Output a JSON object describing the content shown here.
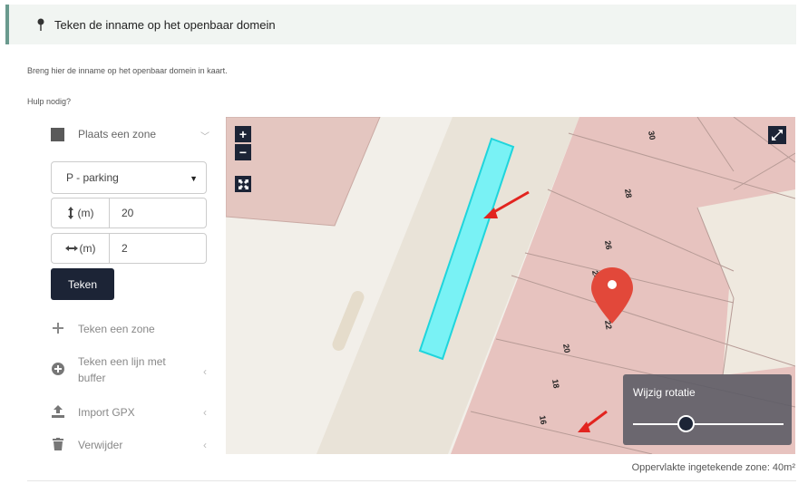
{
  "header": {
    "title": "Teken de inname op het openbaar domein",
    "icon": "map-pin-icon"
  },
  "intro": "Breng hier de inname op het openbaar domein in kaart.",
  "help": "Hulp nodig?",
  "sidebar": {
    "zone_header": "Plaats een zone",
    "select_value": "P - parking",
    "length": {
      "label": "(m)",
      "value": "20"
    },
    "width": {
      "label": "(m)",
      "value": "2"
    },
    "draw_button": "Teken",
    "tools": [
      {
        "label": "Teken een zone",
        "icon": "plus-icon"
      },
      {
        "label": "Teken een lijn met buffer",
        "icon": "plus-circle-icon"
      },
      {
        "label": "Import GPX",
        "icon": "upload-icon"
      },
      {
        "label": "Verwijder",
        "icon": "trash-icon"
      }
    ]
  },
  "map": {
    "zoom_in": "+",
    "zoom_out": "−",
    "house_numbers": [
      "30",
      "28",
      "26",
      "24",
      "22",
      "20",
      "18",
      "16"
    ],
    "rotation_label": "Wijzig rotatie",
    "rotation_value": 0.35,
    "colors": {
      "parcel": "#e7c3bf",
      "zone": "#79f2f5",
      "marker": "#e2483a",
      "road": "#e9e3d8"
    }
  },
  "footer": {
    "area_text": "Oppervlakte ingetekende zone: 40m²"
  }
}
